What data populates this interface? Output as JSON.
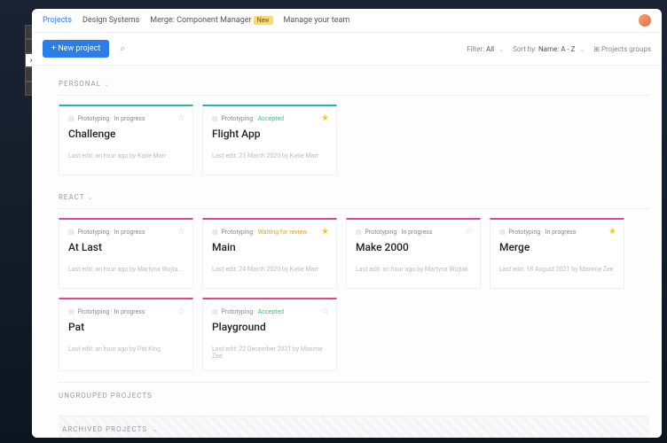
{
  "nav": {
    "items": [
      "Projects",
      "Design Systems",
      "Merge: Component Manager",
      "Manage your team"
    ],
    "badge": "New"
  },
  "toolbar": {
    "new_project": "+ New project",
    "filter_label": "Filter:",
    "filter_value": "All",
    "sort_label": "Sort by:",
    "sort_value": "Name: A - Z",
    "groups": "Projects groups"
  },
  "sections": {
    "personal": {
      "title": "Personal",
      "cards": [
        {
          "status": "Prototyping",
          "phase": "In progress",
          "phaseClass": "",
          "title": "Challenge",
          "meta": "Last edit: an hour ago by Katie Marr",
          "starred": false,
          "color": "teal"
        },
        {
          "status": "Prototyping",
          "phase": "Accepted",
          "phaseClass": "accepted",
          "title": "Flight App",
          "meta": "Last edit: 23 March 2020 by Katie Marr",
          "starred": true,
          "color": "teal"
        }
      ]
    },
    "react": {
      "title": "React",
      "cards": [
        {
          "status": "Prototyping",
          "phase": "In progress",
          "phaseClass": "",
          "title": "At Last",
          "meta": "Last edit: an hour ago by Martyna Wojta...",
          "starred": false,
          "color": "pink"
        },
        {
          "status": "Prototyping",
          "phase": "Waiting for review",
          "phaseClass": "waiting",
          "title": "Main",
          "meta": "Last edit: 24 March 2020 by Katie Marr",
          "starred": true,
          "color": "pink"
        },
        {
          "status": "Prototyping",
          "phase": "In progress",
          "phaseClass": "",
          "title": "Make 2000",
          "meta": "Last edit: an hour ago by Martyna Wojtak",
          "starred": false,
          "color": "pink"
        },
        {
          "status": "Prototyping",
          "phase": "In progress",
          "phaseClass": "",
          "title": "Merge",
          "meta": "Last edit: 18 August 2021 by Maxime Zee",
          "starred": true,
          "color": "pink"
        },
        {
          "status": "Prototyping",
          "phase": "In progress",
          "phaseClass": "",
          "title": "Pat",
          "meta": "Last edit: an hour ago by Pat King",
          "starred": false,
          "color": "pink"
        },
        {
          "status": "Prototyping",
          "phase": "Accepted",
          "phaseClass": "accepted",
          "title": "Playground",
          "meta": "Last edit: 22 December 2021 by Maxime Zee",
          "starred": false,
          "color": "pink"
        }
      ]
    },
    "ungrouped": "Ungrouped Projects",
    "archived": "Archived Projects"
  }
}
